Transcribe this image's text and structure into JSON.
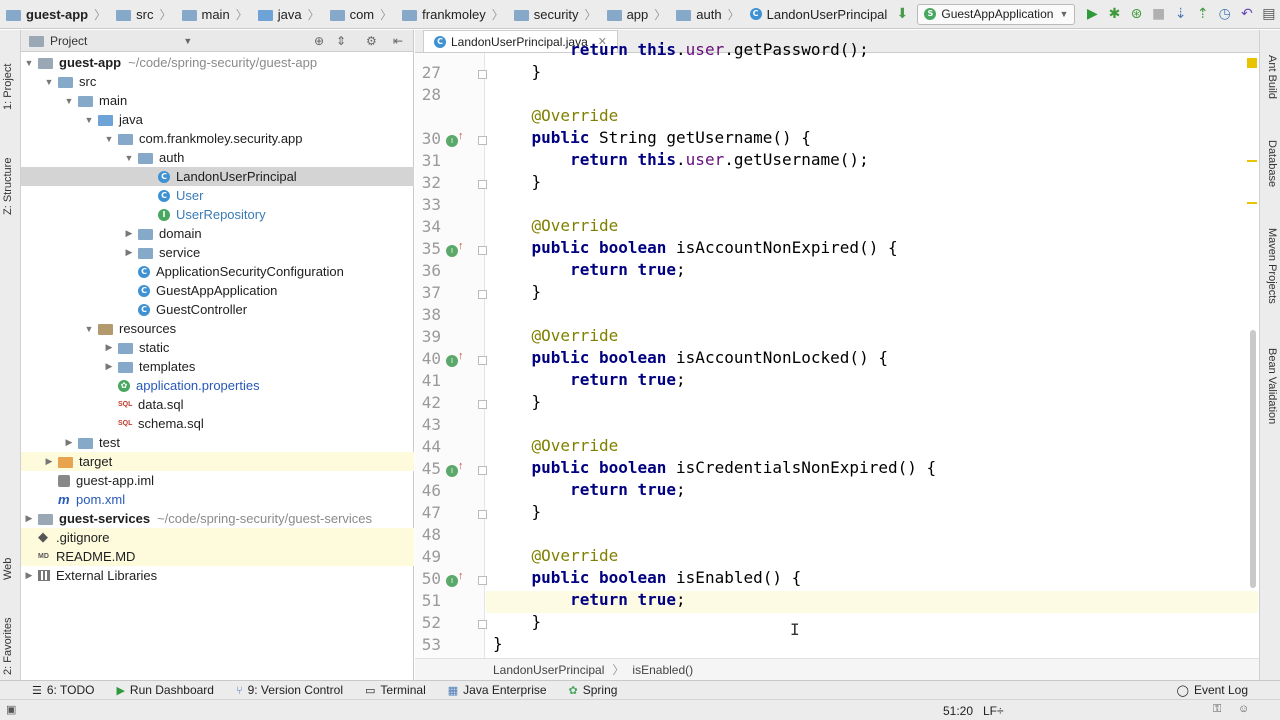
{
  "nav": {
    "breadcrumbs": [
      "guest-app",
      "src",
      "main",
      "java",
      "com",
      "frankmoley",
      "security",
      "app",
      "auth",
      "LandonUserPrincipal"
    ],
    "run_config": "GuestAppApplication"
  },
  "left_strip": {
    "project_tab": "1: Project",
    "structure_tab": "Z: Structure",
    "web_tab": "Web",
    "favorites_tab": "2: Favorites"
  },
  "right_strip": {
    "ant": "Ant Build",
    "database": "Database",
    "maven": "Maven Projects",
    "bean": "Bean Validation"
  },
  "project_panel": {
    "title": "Project",
    "rows": [
      {
        "label": "guest-app",
        "extra": "~/code/spring-security/guest-app"
      },
      {
        "label": "src"
      },
      {
        "label": "main"
      },
      {
        "label": "java"
      },
      {
        "label": "com.frankmoley.security.app"
      },
      {
        "label": "auth"
      },
      {
        "label": "LandonUserPrincipal"
      },
      {
        "label": "User"
      },
      {
        "label": "UserRepository"
      },
      {
        "label": "domain"
      },
      {
        "label": "service"
      },
      {
        "label": "ApplicationSecurityConfiguration"
      },
      {
        "label": "GuestAppApplication"
      },
      {
        "label": "GuestController"
      },
      {
        "label": "resources"
      },
      {
        "label": "static"
      },
      {
        "label": "templates"
      },
      {
        "label": "application.properties"
      },
      {
        "label": "data.sql"
      },
      {
        "label": "schema.sql"
      },
      {
        "label": "test"
      },
      {
        "label": "target"
      },
      {
        "label": "guest-app.iml"
      },
      {
        "label": "pom.xml"
      },
      {
        "label": "guest-services",
        "extra": "~/code/spring-security/guest-services"
      },
      {
        "label": ".gitignore"
      },
      {
        "label": "README.MD"
      },
      {
        "label": "External Libraries"
      }
    ]
  },
  "editor": {
    "tab_label": "LandonUserPrincipal.java",
    "line_numbers": [
      "27",
      "28",
      "30",
      "31",
      "32",
      "33",
      "34",
      "35",
      "36",
      "37",
      "38",
      "39",
      "40",
      "41",
      "42",
      "43",
      "44",
      "45",
      "46",
      "47",
      "48",
      "49",
      "50",
      "51",
      "52",
      "53"
    ],
    "breadcrumb": [
      "LandonUserPrincipal",
      "isEnabled()"
    ]
  },
  "bottom_tools": [
    "6: TODO",
    "Run Dashboard",
    "9: Version Control",
    "Terminal",
    "Java Enterprise",
    "Spring",
    "Event Log"
  ],
  "status": {
    "position": "51:20",
    "line_sep": "LF÷"
  }
}
